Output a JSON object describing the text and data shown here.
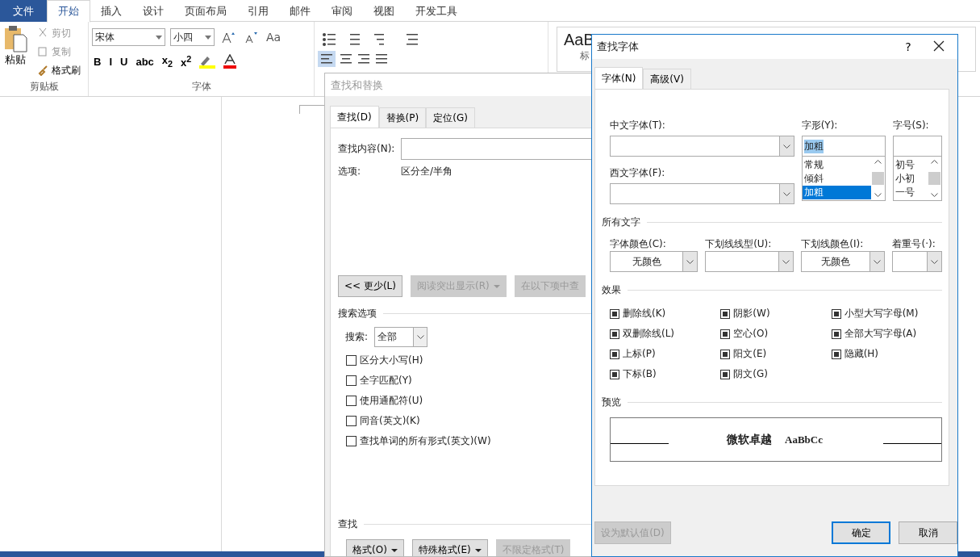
{
  "ribbon": {
    "tabs": [
      {
        "label": "文件",
        "kind": "file",
        "selected": false
      },
      {
        "label": "开始",
        "kind": "tab",
        "selected": true
      },
      {
        "label": "插入",
        "kind": "tab",
        "selected": false
      },
      {
        "label": "设计",
        "kind": "tab",
        "selected": false
      },
      {
        "label": "页面布局",
        "kind": "tab",
        "selected": false
      },
      {
        "label": "引用",
        "kind": "tab",
        "selected": false
      },
      {
        "label": "邮件",
        "kind": "tab",
        "selected": false
      },
      {
        "label": "审阅",
        "kind": "tab",
        "selected": false
      },
      {
        "label": "视图",
        "kind": "tab",
        "selected": false
      },
      {
        "label": "开发工具",
        "kind": "tab",
        "selected": false
      }
    ],
    "clipboard": {
      "paste": "粘贴",
      "items": [
        {
          "label": "剪切",
          "disabled": true
        },
        {
          "label": "复制",
          "disabled": true
        },
        {
          "label": "格式刷",
          "disabled": false
        }
      ],
      "title": "剪贴板"
    },
    "font": {
      "name": "宋体",
      "size": "小四",
      "case_button": "Aa",
      "format_buttons": [
        "B",
        "I",
        "U",
        "abc",
        "x$_{2}$",
        "x$^{2}$"
      ],
      "title": "字体"
    },
    "styles": {
      "sample": "AaB",
      "caption": "标"
    }
  },
  "find_dialog": {
    "title": "查找和替换",
    "tabs": [
      {
        "label": "查找(D)",
        "selected": true
      },
      {
        "label": "替换(P)",
        "selected": false
      },
      {
        "label": "定位(G)",
        "selected": false
      }
    ],
    "find_label": "查找内容(N):",
    "options_label": "选项:",
    "options_value": "区分全/半角",
    "buttons": [
      {
        "label": "<< 更少(L)",
        "disabled": false,
        "dropdown": false
      },
      {
        "label": "阅读突出显示(R)",
        "disabled": true,
        "dropdown": true
      },
      {
        "label": "在以下项中查",
        "disabled": true,
        "dropdown": false
      }
    ],
    "search_options_title": "搜索选项",
    "search_label": "搜索:",
    "search_value": "全部",
    "checkboxes": [
      {
        "label": "区分大小写(H)",
        "checked": false
      },
      {
        "label": "全字匹配(Y)",
        "checked": false
      },
      {
        "label": "使用通配符(U)",
        "checked": false
      },
      {
        "label": "同音(英文)(K)",
        "checked": false
      },
      {
        "label": "查找单词的所有形式(英文)(W)",
        "checked": false
      }
    ],
    "find_title": "查找",
    "bottom_buttons": [
      {
        "label": "格式(O)",
        "disabled": false,
        "dropdown": true
      },
      {
        "label": "特殊格式(E)",
        "disabled": false,
        "dropdown": true
      },
      {
        "label": "不限定格式(T)",
        "disabled": true,
        "dropdown": false
      }
    ]
  },
  "font_dialog": {
    "title": "查找字体",
    "help": "?",
    "tabs": [
      {
        "label": "字体(N)",
        "selected": true
      },
      {
        "label": "高级(V)",
        "selected": false
      }
    ],
    "chinese_font_label": "中文字体(T):",
    "western_font_label": "西文字体(F):",
    "style_label": "字形(Y):",
    "style_value": "加粗",
    "style_options": [
      {
        "label": "常规",
        "selected": false
      },
      {
        "label": "倾斜",
        "selected": false
      },
      {
        "label": "加粗",
        "selected": true
      }
    ],
    "size_label": "字号(S):",
    "size_options": [
      {
        "label": "初号",
        "selected": false
      },
      {
        "label": "小初",
        "selected": false
      },
      {
        "label": "一号",
        "selected": false
      }
    ],
    "all_text_title": "所有文字",
    "combos": [
      {
        "label": "字体颜色(C):",
        "value": "无颜色"
      },
      {
        "label": "下划线线型(U):"
      },
      {
        "label": "下划线颜色(I):",
        "value": "无颜色"
      },
      {
        "label": "着重号(·):"
      }
    ],
    "effects_title": "效果",
    "effects": [
      [
        {
          "label": "删除线(K)",
          "indeterminate": true
        },
        {
          "label": "双删除线(L)",
          "indeterminate": true
        },
        {
          "label": "上标(P)",
          "indeterminate": true
        },
        {
          "label": "下标(B)",
          "indeterminate": true
        }
      ],
      [
        {
          "label": "阴影(W)",
          "indeterminate": true
        },
        {
          "label": "空心(O)",
          "indeterminate": true
        },
        {
          "label": "阳文(E)",
          "indeterminate": true
        },
        {
          "label": "阴文(G)",
          "indeterminate": true
        }
      ],
      [
        {
          "label": "小型大写字母(M)",
          "indeterminate": true
        },
        {
          "label": "全部大写字母(A)",
          "indeterminate": true
        },
        {
          "label": "隐藏(H)",
          "indeterminate": true
        }
      ]
    ],
    "preview_title": "预览",
    "preview_cn": "微软卓越",
    "preview_en": "AaBbCc",
    "buttons": [
      {
        "label": "设为默认值(D)",
        "disabled": true,
        "default": false
      },
      {
        "label": "确定",
        "disabled": false,
        "default": true
      },
      {
        "label": "取消",
        "disabled": false,
        "default": false
      }
    ]
  }
}
